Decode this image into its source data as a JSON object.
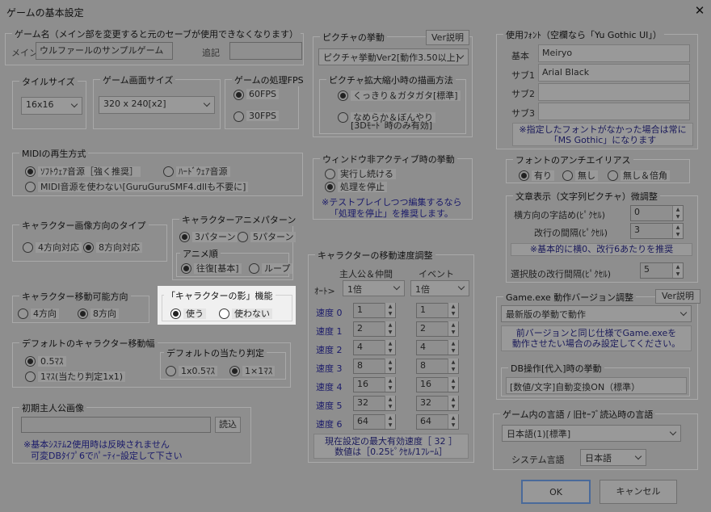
{
  "window": {
    "title": "ゲームの基本設定"
  },
  "game_name": {
    "label": "ゲーム名（メイン部を変更すると元のセーブが使用できなくなります）",
    "main_label": "メイン",
    "main_value": "ウルファールのサンプルゲーム",
    "sub_label": "追記",
    "sub_value": ""
  },
  "tile_size": {
    "label": "タイルサイズ",
    "value": "16x16"
  },
  "screen_size": {
    "label": "ゲーム画面サイズ",
    "value": "320 x 240[x2]"
  },
  "fps": {
    "label": "ゲームの処理FPS",
    "options": [
      "60FPS",
      "30FPS"
    ],
    "selected": 0
  },
  "picture_behavior": {
    "label": "ピクチャの挙動",
    "help": "Ver説明",
    "value": "ピクチャ挙動Ver2[動作3.50以上]",
    "scale_label": "ピクチャ拡大縮小時の描画方法",
    "scale_opt1": "くっきり＆ガタガタ[標準]",
    "scale_opt2a": "なめらか＆ぼんやり",
    "scale_opt2b": "[3Dﾓｰﾄﾞ時のみ有効]"
  },
  "midi": {
    "label": "MIDIの再生方式",
    "opt1": "ｿﾌﾄｳｪｱ音源［強く推奨］",
    "opt2": "ﾊｰﾄﾞｳｪｱ音源",
    "opt3": "MIDI音源を使わない[GuruGuruSMF4.dllも不要に]"
  },
  "inactive": {
    "label": "ウィンドウ非アクティブ時の挙動",
    "opt1": "実行し続ける",
    "opt2": "処理を停止",
    "note1": "※テストプレイしつつ編集するなら",
    "note2": "「処理を停止」を推奨します。"
  },
  "char_dir": {
    "label": "キャラクター画像方向のタイプ",
    "opt1": "4方向対応",
    "opt2": "8方向対応"
  },
  "char_anim": {
    "label": "キャラクターアニメパターン",
    "opt1": "3パターン",
    "opt2": "5パターン",
    "order_label": "アニメ順",
    "order1": "往復[基本]",
    "order2": "ループ"
  },
  "char_move_dir": {
    "label": "キャラクター移動可能方向",
    "opt1": "4方向",
    "opt2": "8方向"
  },
  "shadow": {
    "label": "「キャラクターの影」機能",
    "opt1": "使う",
    "opt2": "使わない"
  },
  "move_width": {
    "label": "デフォルトのキャラクター移動幅",
    "opt1": "0.5ﾏｽ",
    "opt2": "1ﾏｽ(当たり判定1x1)",
    "hit_label": "デフォルトの当たり判定",
    "hit1": "1x0.5ﾏｽ",
    "hit2": "1×1ﾏｽ"
  },
  "speed": {
    "label": "キャラクターの移動速度調整",
    "col1": "主人公＆仲間",
    "col2": "イベント",
    "auto_label": "ｵｰﾄ>",
    "auto1": "1倍",
    "auto2": "1倍",
    "rows": [
      {
        "label": "速度 0",
        "p": "1",
        "e": "1"
      },
      {
        "label": "速度 1",
        "p": "2",
        "e": "2"
      },
      {
        "label": "速度 2",
        "p": "4",
        "e": "4"
      },
      {
        "label": "速度 3",
        "p": "8",
        "e": "8"
      },
      {
        "label": "速度 4",
        "p": "16",
        "e": "16"
      },
      {
        "label": "速度 5",
        "p": "32",
        "e": "32"
      },
      {
        "label": "速度 6",
        "p": "64",
        "e": "64"
      }
    ],
    "note1": "現在設定の最大有効速度［ 32 ］",
    "note2": "数値は［0.25ﾋﾟｸｾﾙ/1ﾌﾚｰﾑ］"
  },
  "hero_image": {
    "label": "初期主人公画像",
    "value": "",
    "load": "読込",
    "note1": "※基本ｼｽﾃﾑ2使用時は反映されません",
    "note2": "可変DBﾀｲﾌﾟ6でﾊﾟｰﾃｨｰ設定して下さい"
  },
  "fonts": {
    "label": "使用ﾌｫﾝﾄ（空欄なら「Yu Gothic UI」）",
    "rows": [
      {
        "label": "基本",
        "value": "Meiryo"
      },
      {
        "label": "サブ1",
        "value": "Arial Black"
      },
      {
        "label": "サブ2",
        "value": ""
      },
      {
        "label": "サブ3",
        "value": ""
      }
    ],
    "note1": "※指定したフォントがなかった場合は常に",
    "note2": "「MS Gothic」になります"
  },
  "antialias": {
    "label": "フォントのアンチエイリアス",
    "opt1": "有り",
    "opt2": "無し",
    "opt3": "無し＆倍角"
  },
  "text_display": {
    "label": "文章表示（文字列ピクチャ）微調整",
    "h_label": "横方向の字詰め(ﾋﾟｸｾﾙ)",
    "h_value": "0",
    "lf_label": "改行の間隔(ﾋﾟｸｾﾙ)",
    "lf_value": "3",
    "note": "※基本的に横0、改行6あたりを推奨",
    "choice_label": "選択肢の改行間隔(ﾋﾟｸｾﾙ)",
    "choice_value": "5"
  },
  "exe_version": {
    "label": "Game.exe 動作バージョン調整",
    "help": "Ver説明",
    "value": "最新版の挙動で動作",
    "note1": "前バージョンと同じ仕様でGame.exeを",
    "note2": "動作させたい場合のみ設定してください。",
    "db_label": "DB操作[代入]時の挙動",
    "db_value": "[数値/文字]自動変換ON（標準）"
  },
  "language": {
    "label": "ゲーム内の言語 / 旧ｾｰﾌﾞ読込時の言語",
    "value": "日本語(1)[標準]",
    "sys_label": "システム言語",
    "sys_value": "日本語"
  },
  "footer": {
    "ok": "OK",
    "cancel": "キャンセル"
  }
}
